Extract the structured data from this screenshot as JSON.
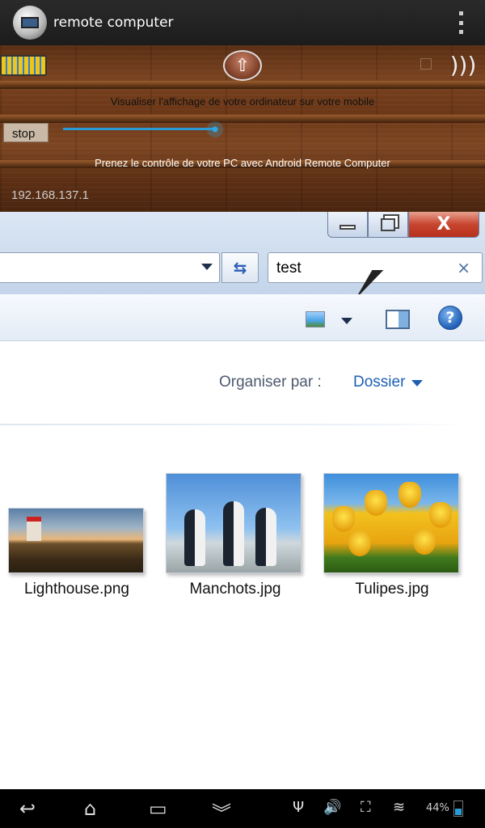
{
  "app": {
    "title": "remote computer",
    "icon": "remote-computer-app-icon"
  },
  "toolbar": {
    "up_symbol": "⇧",
    "speaker_symbol": ")))",
    "line1": "Visualiser l'affichage de votre ordinateur sur votre mobile",
    "stop_label": "stop",
    "line2": "Prenez le contrôle de votre PC avec Android Remote Computer",
    "ip": "192.168.137.1",
    "seek_level": 0.96
  },
  "explorer": {
    "close_symbol": "X",
    "search_value": "test",
    "search_clear": "×",
    "refresh_symbol": "⇆",
    "help_symbol": "?",
    "organise_label": "Organiser par :",
    "organise_value": "Dossier",
    "files": [
      {
        "name": "Lighthouse.png"
      },
      {
        "name": "Manchots.jpg"
      },
      {
        "name": "Tulipes.jpg"
      }
    ]
  },
  "navbar": {
    "back": "↩",
    "home": "⌂",
    "recent": "▭",
    "menu": "︾",
    "usb": "Ψ",
    "volume": "🔊",
    "screenshot": "⛶",
    "wifi": "≋",
    "battery_text": "44%",
    "battery_level": 0.44
  },
  "colors": {
    "accent": "#2c9ad4",
    "window_close": "#c7452f",
    "link": "#1e5fb4"
  }
}
